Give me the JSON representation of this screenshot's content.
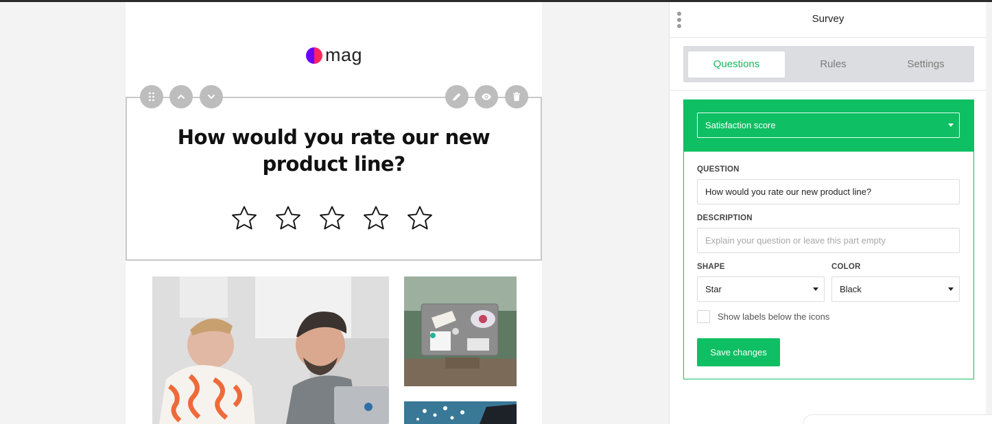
{
  "email": {
    "logo_text": "mag",
    "question_title": "How would you rate our new product line?",
    "rating": {
      "max": 5,
      "selected": 0,
      "shape": "star-icon"
    },
    "controls": {
      "left": [
        "drag-handle-icon",
        "chevron-up-icon",
        "chevron-down-icon"
      ],
      "right": [
        "pencil-icon",
        "eye-icon",
        "trash-icon"
      ]
    }
  },
  "panel": {
    "title": "Survey",
    "tabs": [
      "Questions",
      "Rules",
      "Settings"
    ],
    "active_tab": "Questions",
    "question_type": "Satisfaction score",
    "question_label": "QUESTION",
    "question_value": "How would you rate our new product line?",
    "description_label": "DESCRIPTION",
    "description_placeholder": "Explain your question or leave this part empty",
    "shape_label": "SHAPE",
    "shape_value": "Star",
    "color_label": "COLOR",
    "color_value": "Black",
    "show_labels_text": "Show labels below the icons",
    "show_labels_checked": false,
    "save_label": "Save changes"
  },
  "colors": {
    "accent": "#0fbf63",
    "text": "#111111"
  }
}
